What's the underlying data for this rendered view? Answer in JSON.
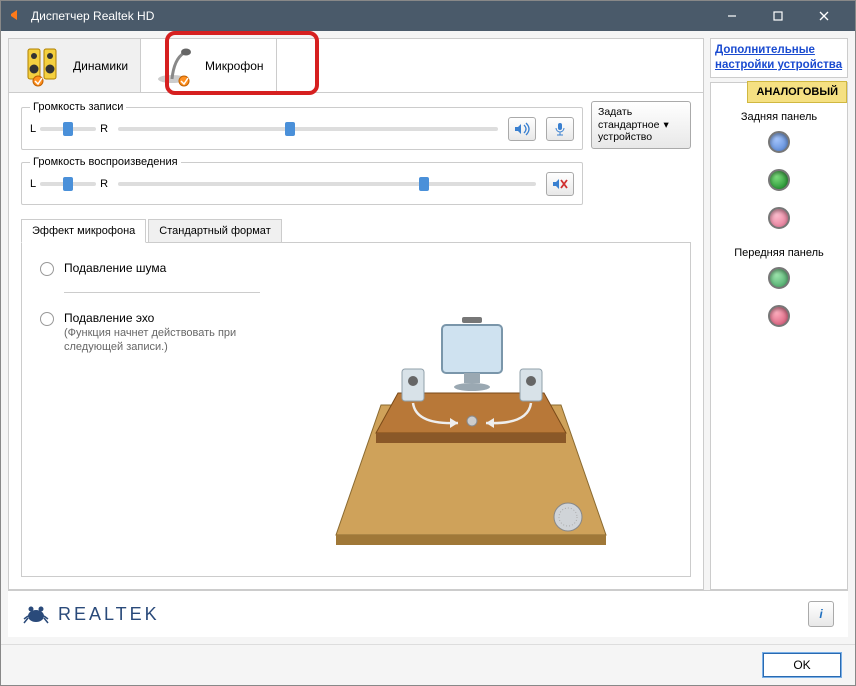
{
  "window": {
    "title": "Диспетчер Realtek HD"
  },
  "sidebar": {
    "adv_link": "Дополнительные настройки устройства",
    "analog": "АНАЛОГОВЫЙ",
    "rear": "Задняя панель",
    "front": "Передняя панель"
  },
  "device_tabs": {
    "speakers": "Динамики",
    "microphone": "Микрофон"
  },
  "sliders": {
    "rec_group": "Громкость записи",
    "play_group": "Громкость воспроизведения",
    "L": "L",
    "R": "R"
  },
  "set_default": {
    "line1": "Задать",
    "line2": "стандартное",
    "line3": "устройство"
  },
  "subtabs": {
    "effect": "Эффект микрофона",
    "format": "Стандартный формат"
  },
  "effects": {
    "noise": "Подавление шума",
    "echo": "Подавление эхо",
    "echo_sub": "(Функция начнет действовать при следующей записи.)"
  },
  "footer": {
    "logo": "REALTEK"
  },
  "buttons": {
    "ok": "OK"
  }
}
